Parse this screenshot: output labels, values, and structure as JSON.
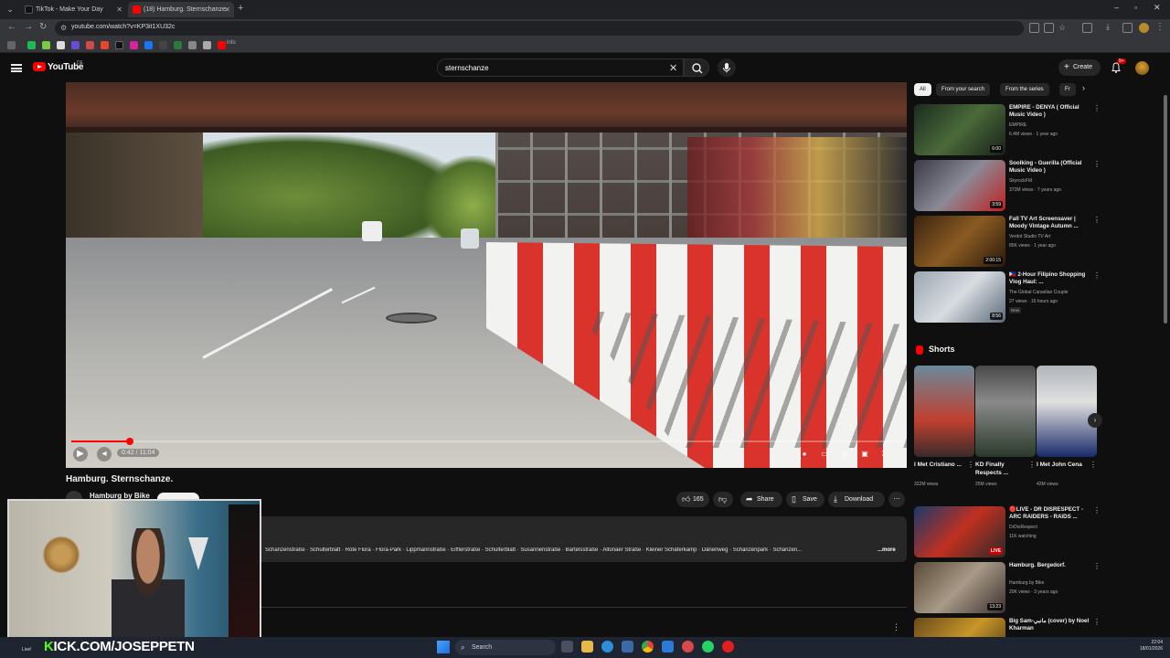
{
  "browser": {
    "tabs": [
      {
        "title": "TikTok - Make Your Day",
        "color": "#111111"
      },
      {
        "title": "(18) Hamburg. Sternschanze.",
        "color": "#ff0000"
      }
    ],
    "url": "youtube.com/watch?v=KP3it1XU32c",
    "bookmark_label": "info"
  },
  "youtube": {
    "logo_text": "YouTube",
    "region": "DE",
    "search_value": "sternschanze",
    "create_label": "Create",
    "notif_badge": "9+"
  },
  "video": {
    "title": "Hamburg. Sternschanze.",
    "channel": "Hamburg by Bike",
    "progress": 0.07,
    "time": "0:42 / 11:04",
    "likes": "165",
    "share_label": "Share",
    "save_label": "Save",
    "download_label": "Download",
    "description_line": "Schanzenstraße · Schulterblatt · Rote Flora · Flora-Park · Lippmannstraße · Eifflerstraße · Schulterblatt · Susannenstraße · Bartelsstraße · Altonaer Straße · Kleiner Schäferkamp · Dänenweg · Schanzenpark · Schanzen...",
    "description_more": "...more"
  },
  "sidebar": {
    "chips": [
      "All",
      "From your search",
      "From the series",
      "Fr"
    ],
    "recs_top": [
      {
        "title": "EMPIRE - DENYA ( Official Music Video )",
        "channel": "EMPIRE",
        "meta": "6.4M views · 1 year ago",
        "duration": "6:00",
        "thumb": "linear-gradient(135deg,#1a2a1e,#4a6a3a 50%,#182018)"
      },
      {
        "title": "Soolking - Guerilla (Official Music Video )",
        "channel": "SkyrockFM",
        "meta": "373M views · 7 years ago",
        "duration": "3:59",
        "thumb": "linear-gradient(135deg,#3a3a48,#8a8a96 50%,#c02020)"
      },
      {
        "title": "Fall TV Art Screensaver | Moody Vintage Autumn ...",
        "channel": "Verdot Studio TV Art",
        "meta": "85K views · 1 year ago",
        "duration": "2:00:15",
        "thumb": "linear-gradient(135deg,#3a2410,#8a5a22 50%,#2a1a0a)"
      },
      {
        "title": "🇵🇭 2-Hour Filipino Shopping Vlog Haul: ...",
        "channel": "The Global Canadian Couple",
        "meta": "27 views · 16 hours ago",
        "badge": "New",
        "duration": "8:56",
        "thumb": "linear-gradient(135deg,#9aa6b2,#d8dce0 50%,#5a6a7a)"
      }
    ],
    "shorts_title": "Shorts",
    "shorts": [
      {
        "title": "I Met Cristiano ...",
        "views": "322M views",
        "thumb": "linear-gradient(#6a8a9a,#c04030 60%,#3a2a2a)"
      },
      {
        "title": "KD Finally Respects ...",
        "views": "25M views",
        "thumb": "linear-gradient(#4a4a4a,#8a8a8a 40%,#2a3a2a)"
      },
      {
        "title": "I Met John Cena",
        "views": "42M views",
        "thumb": "linear-gradient(#b0b4b8,#e0e0e0 40%,#1a2a6a)"
      }
    ],
    "recs_bottom": [
      {
        "title": "🔴LIVE - DR DISRESPECT - ARC RAIDERS - RAIDS ...",
        "channel": "DrDisRespect",
        "meta": "11K watching",
        "live": "LIVE",
        "thumb": "linear-gradient(135deg,#1a3a6a,#c03020 50%,#2a2a2a)"
      },
      {
        "title": "Hamburg. Bergedorf.",
        "channel": "Hamburg by Bike",
        "meta": "20K views · 3 years ago",
        "duration": "13:23",
        "thumb": "linear-gradient(135deg,#5a4a3a,#a89a86 50%,#3a3030)"
      },
      {
        "title": "Big Sam-مانبي (cover) by Noel Kharman",
        "channel": "",
        "meta": "",
        "thumb": "linear-gradient(135deg,#6a4a1a,#c8962a 50%,#3a2a10)"
      }
    ]
  },
  "webcam": {
    "banner_prefix": "K",
    "banner_rest": "ICK.COM/JOSEPPETN",
    "label": "Live!"
  },
  "taskbar": {
    "search_placeholder": "Search",
    "time": "22:04",
    "date": "18/01/2026"
  },
  "colors": {
    "accent": "#ff0000",
    "kick": "#53fc18",
    "bg": "#0f0f0f"
  }
}
